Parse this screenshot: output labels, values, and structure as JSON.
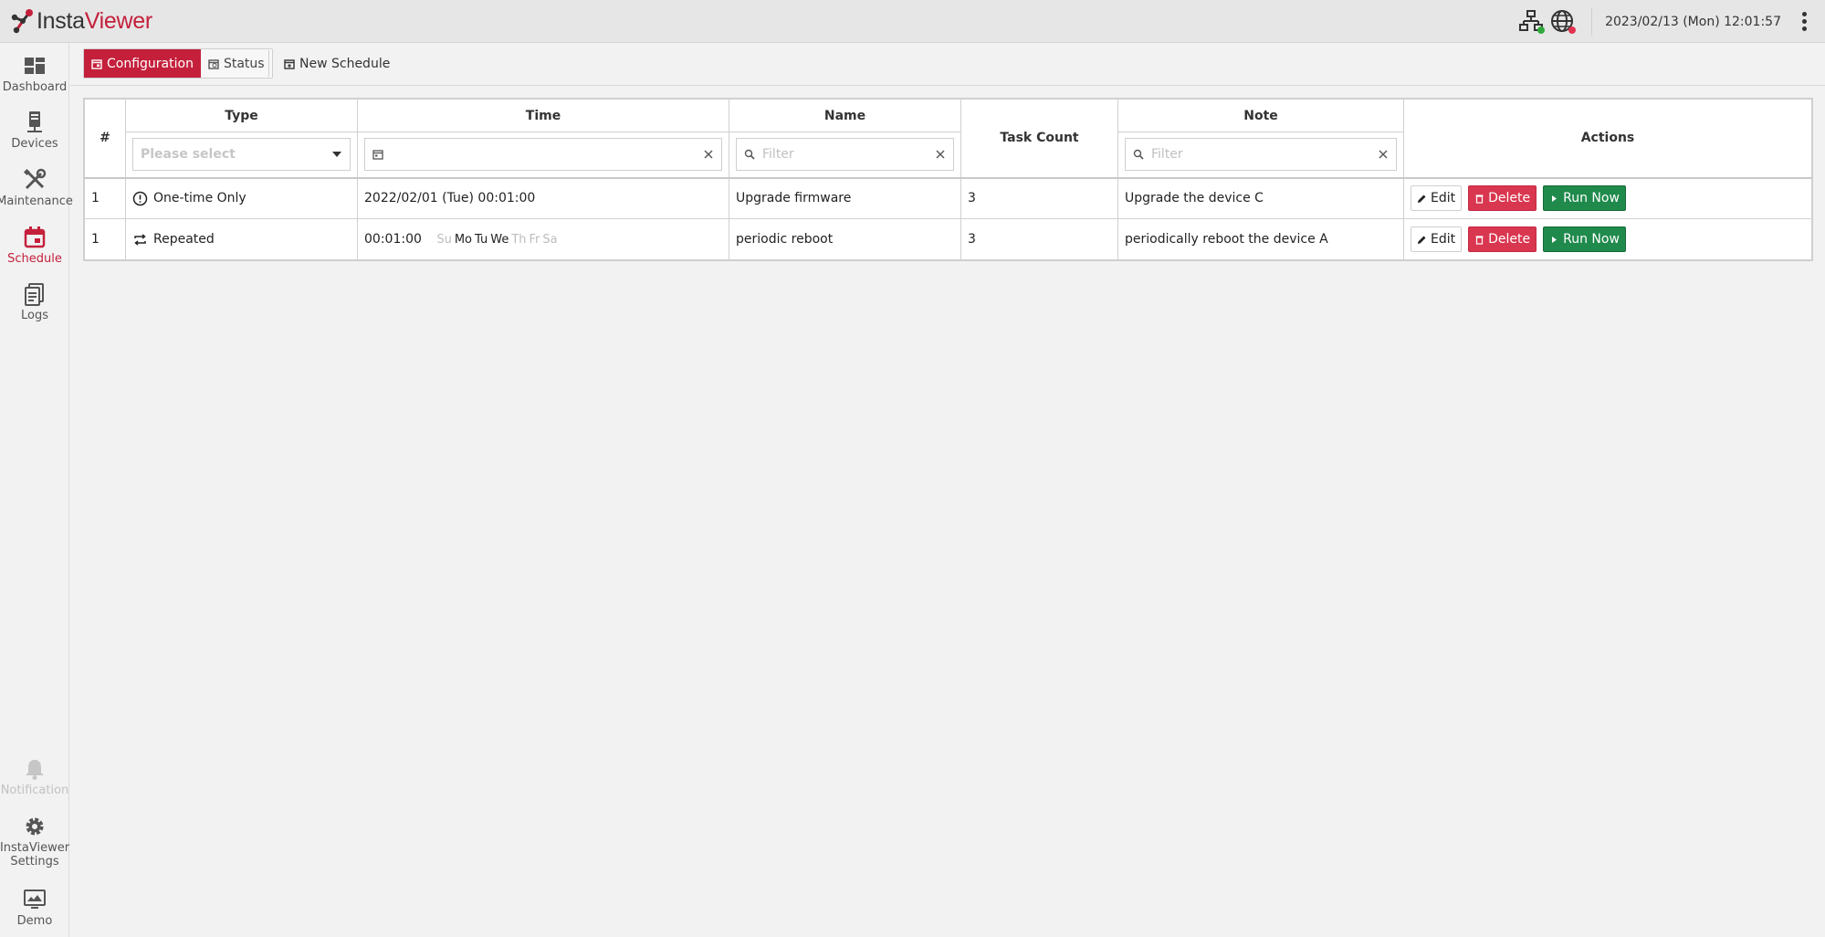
{
  "app": {
    "logo_part1": "Insta",
    "logo_part2": "Viewer",
    "brand_color": "#c4203b"
  },
  "header": {
    "datetime": "2023/02/13 (Mon) 12:01:57",
    "network_status_color": "#2eaa3a",
    "globe_status_color": "#e0334f",
    "icons": [
      "network-icon",
      "globe-icon",
      "more-vertical-icon"
    ]
  },
  "sidebar": {
    "items": [
      {
        "label": "Dashboard",
        "icon": "dashboard-icon"
      },
      {
        "label": "Devices",
        "icon": "server-icon"
      },
      {
        "label": "Maintenance",
        "icon": "tools-icon"
      },
      {
        "label": "Schedule",
        "icon": "calendar-icon",
        "active": true
      },
      {
        "label": "Logs",
        "icon": "document-icon"
      },
      {
        "label": "Notification",
        "icon": "bell-icon",
        "disabled": true
      },
      {
        "label": "InstaViewer Settings",
        "icon": "gear-icon"
      },
      {
        "label": "Demo",
        "icon": "presentation-icon"
      }
    ]
  },
  "toolbar": {
    "tab_configuration": "Configuration",
    "tab_status": "Status",
    "new_schedule": "New Schedule"
  },
  "table": {
    "headers": {
      "index": "#",
      "type": "Type",
      "time": "Time",
      "name": "Name",
      "task_count": "Task Count",
      "note": "Note",
      "actions": "Actions"
    },
    "filters": {
      "type_placeholder": "Please select",
      "time_value": "",
      "name_placeholder": "Filter",
      "note_placeholder": "Filter"
    },
    "action_labels": {
      "edit": "Edit",
      "delete": "Delete",
      "run": "Run Now"
    },
    "rows": [
      {
        "index": "1",
        "type": "One-time Only",
        "type_icon": "clock-icon",
        "time": "2022/02/01 (Tue) 00:01:00",
        "name": "Upgrade firmware",
        "task_count": "3",
        "note": "Upgrade the device C"
      },
      {
        "index": "1",
        "type": "Repeated",
        "type_icon": "repeat-icon",
        "time": "00:01:00",
        "days": [
          {
            "d": "Su",
            "on": false
          },
          {
            "d": "Mo",
            "on": true
          },
          {
            "d": "Tu",
            "on": true
          },
          {
            "d": "We",
            "on": true
          },
          {
            "d": "Th",
            "on": false
          },
          {
            "d": "Fr",
            "on": false
          },
          {
            "d": "Sa",
            "on": false
          }
        ],
        "name": "periodic reboot",
        "task_count": "3",
        "note": "periodically reboot the device A"
      }
    ]
  }
}
